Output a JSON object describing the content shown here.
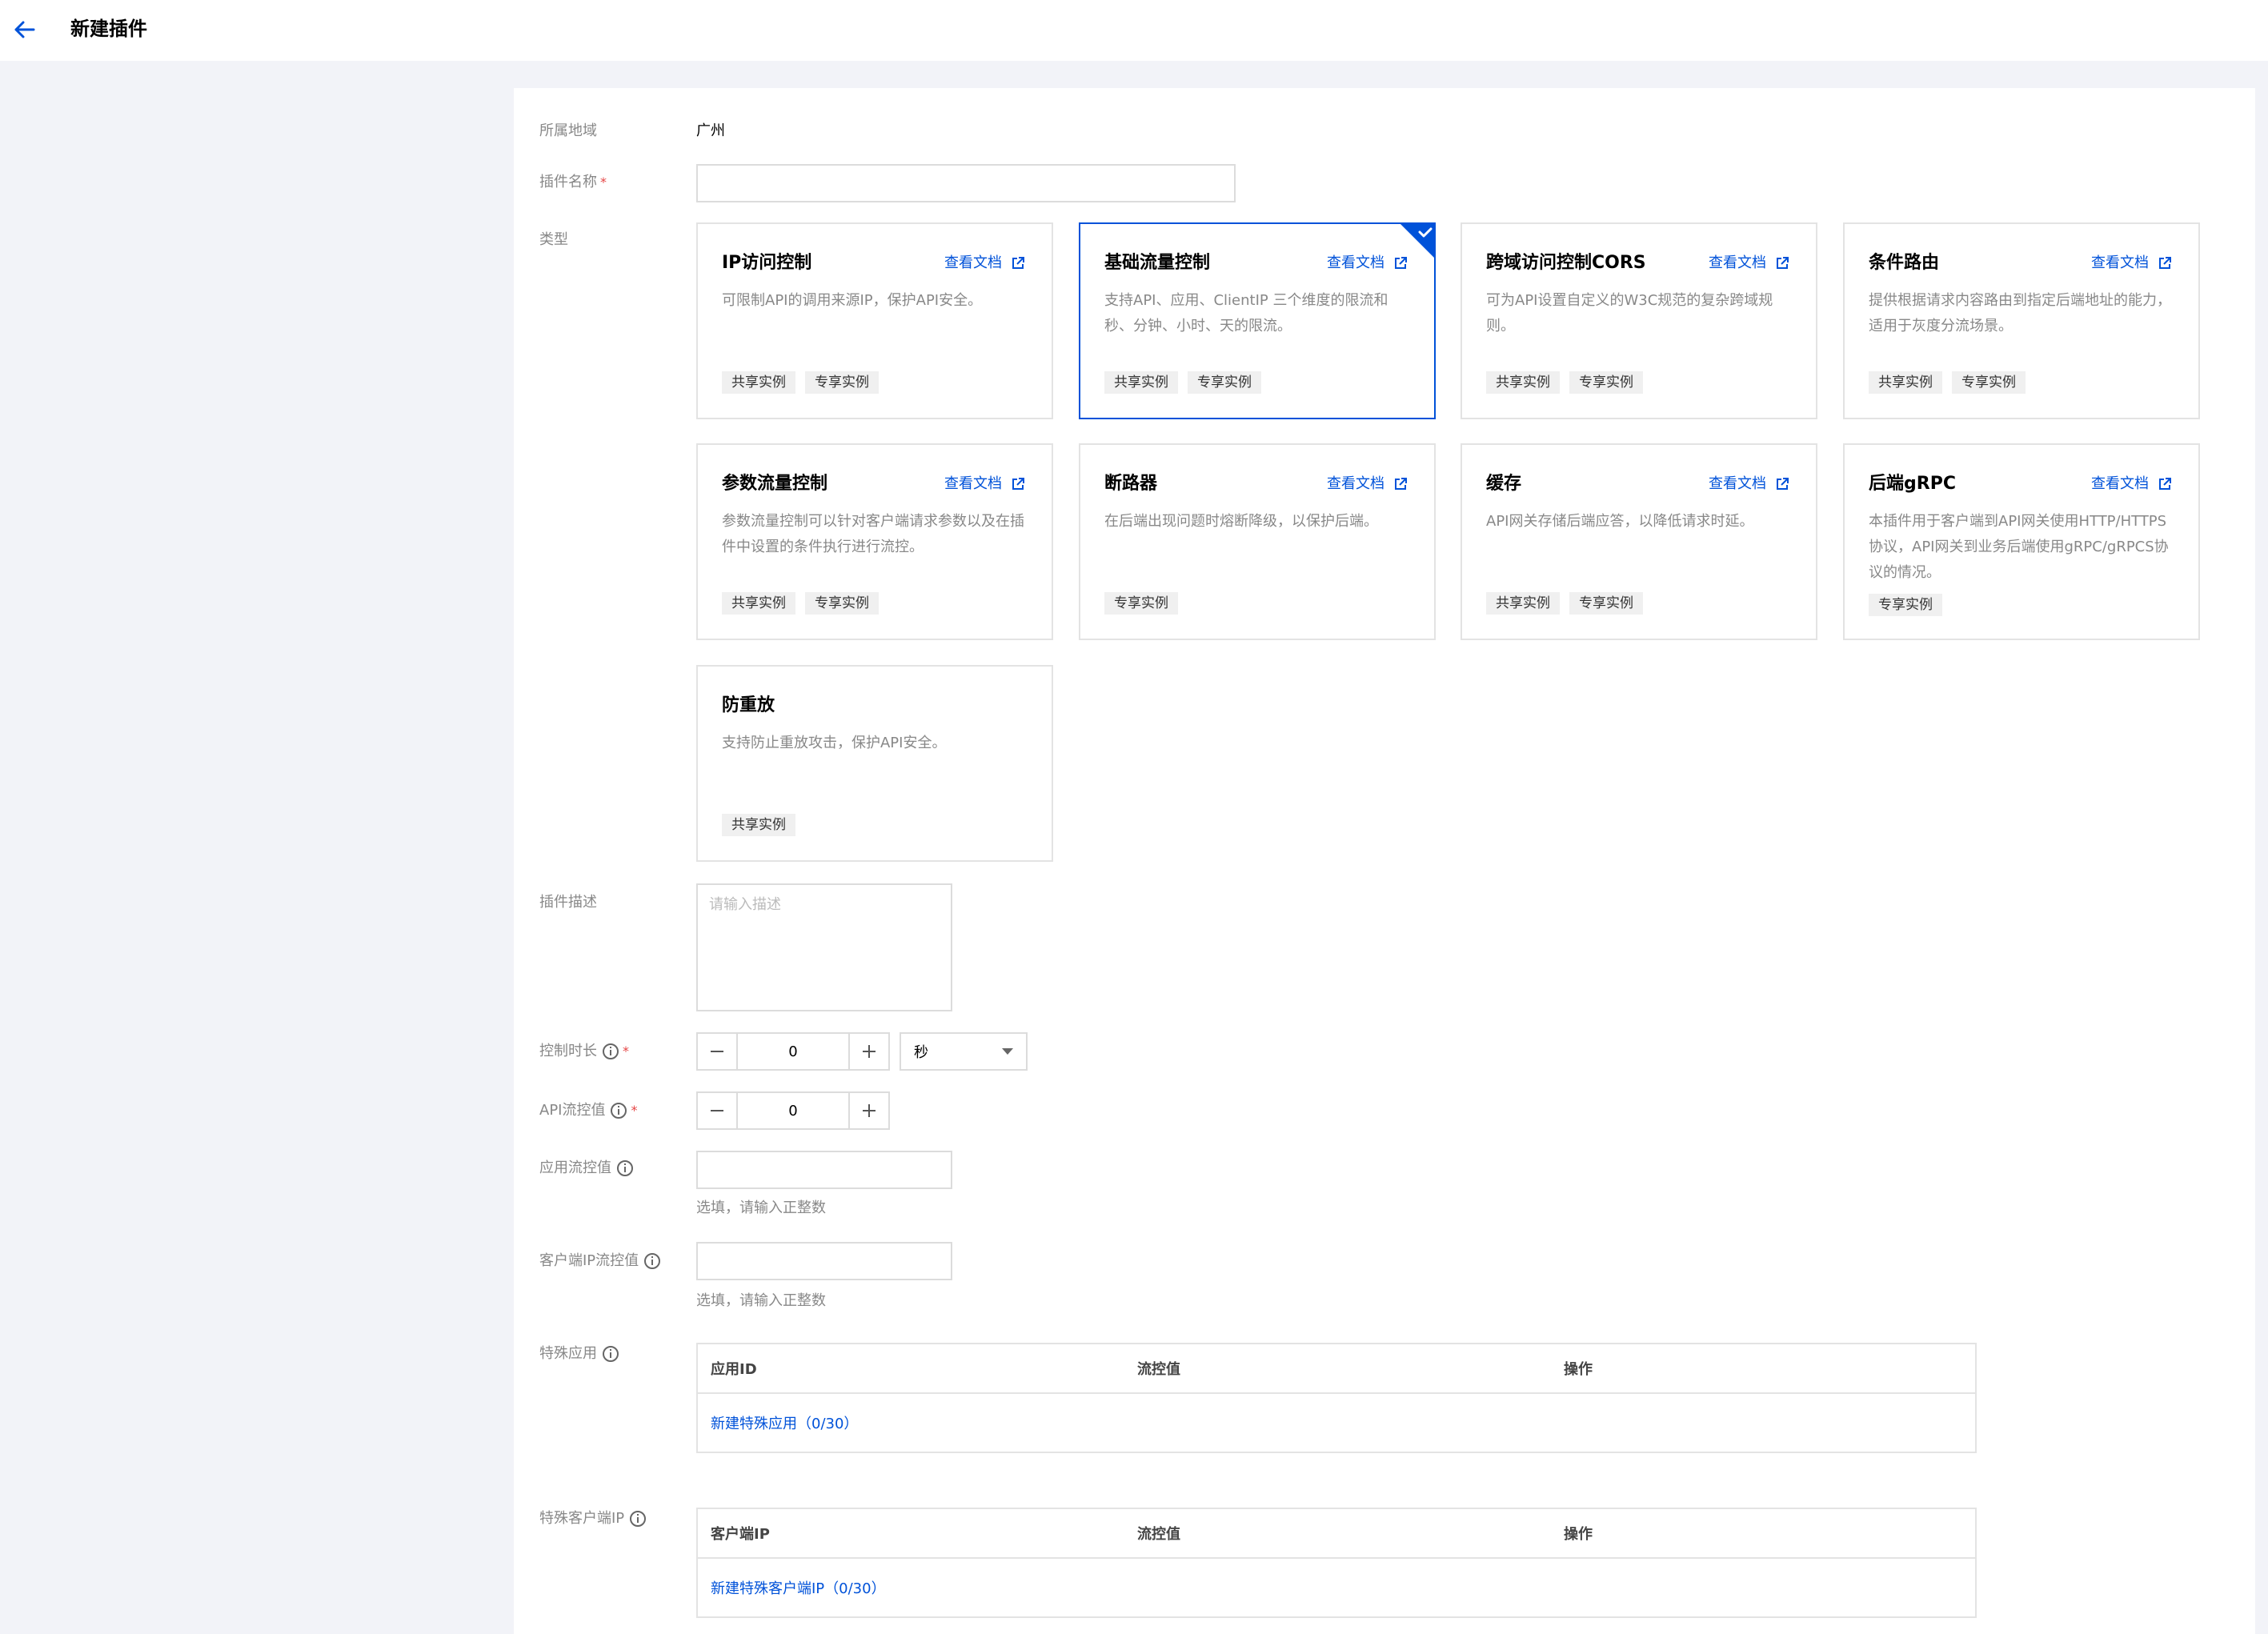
{
  "header": {
    "title": "新建插件"
  },
  "form": {
    "region": {
      "label": "所属地域",
      "value": "广州"
    },
    "name": {
      "label": "插件名称",
      "required_mark": "*",
      "value": ""
    },
    "type": {
      "label": "类型"
    },
    "description": {
      "label": "插件描述",
      "placeholder": "请输入描述"
    },
    "duration": {
      "label": "控制时长",
      "required_mark": "*",
      "value": "0",
      "unit": "秒"
    },
    "api_limit": {
      "label": "API流控值",
      "required_mark": "*",
      "value": "0"
    },
    "app_limit": {
      "label": "应用流控值",
      "hint": "选填，请输入正整数",
      "value": ""
    },
    "client_ip_limit": {
      "label": "客户端IP流控值",
      "hint": "选填，请输入正整数",
      "value": ""
    },
    "special_apps": {
      "label": "特殊应用",
      "columns": [
        "应用ID",
        "流控值",
        "操作"
      ],
      "add_link": "新建特殊应用（0/30）"
    },
    "special_client_ips": {
      "label": "特殊客户端IP",
      "columns": [
        "客户端IP",
        "流控值",
        "操作"
      ],
      "add_link": "新建特殊客户端IP（0/30）"
    }
  },
  "plugin_types": [
    {
      "title": "IP访问控制",
      "doc": "查看文档",
      "desc": "可限制API的调用来源IP，保护API安全。",
      "tags": [
        "共享实例",
        "专享实例"
      ],
      "selected": false
    },
    {
      "title": "基础流量控制",
      "doc": "查看文档",
      "desc": "支持API、应用、ClientIP 三个维度的限流和秒、分钟、小时、天的限流。",
      "tags": [
        "共享实例",
        "专享实例"
      ],
      "selected": true
    },
    {
      "title": "跨域访问控制CORS",
      "doc": "查看文档",
      "desc": "可为API设置自定义的W3C规范的复杂跨域规则。",
      "tags": [
        "共享实例",
        "专享实例"
      ],
      "selected": false
    },
    {
      "title": "条件路由",
      "doc": "查看文档",
      "desc": "提供根据请求内容路由到指定后端地址的能力，适用于灰度分流场景。",
      "tags": [
        "共享实例",
        "专享实例"
      ],
      "selected": false
    },
    {
      "title": "参数流量控制",
      "doc": "查看文档",
      "desc": "参数流量控制可以针对客户端请求参数以及在插件中设置的条件执行进行流控。",
      "tags": [
        "共享实例",
        "专享实例"
      ],
      "selected": false
    },
    {
      "title": "断路器",
      "doc": "查看文档",
      "desc": "在后端出现问题时熔断降级，以保护后端。",
      "tags": [
        "专享实例"
      ],
      "selected": false
    },
    {
      "title": "缓存",
      "doc": "查看文档",
      "desc": "API网关存储后端应答，以降低请求时延。",
      "tags": [
        "共享实例",
        "专享实例"
      ],
      "selected": false
    },
    {
      "title": "后端gRPC",
      "doc": "查看文档",
      "desc": "本插件用于客户端到API网关使用HTTP/HTTPS协议，API网关到业务后端使用gRPC/gRPCS协议的情况。",
      "tags": [
        "专享实例"
      ],
      "selected": false
    },
    {
      "title": "防重放",
      "doc": "",
      "desc": "支持防止重放攻击，保护API安全。",
      "tags": [
        "共享实例"
      ],
      "selected": false
    }
  ],
  "colors": {
    "accent": "#0052d9",
    "required": "#e54545"
  }
}
